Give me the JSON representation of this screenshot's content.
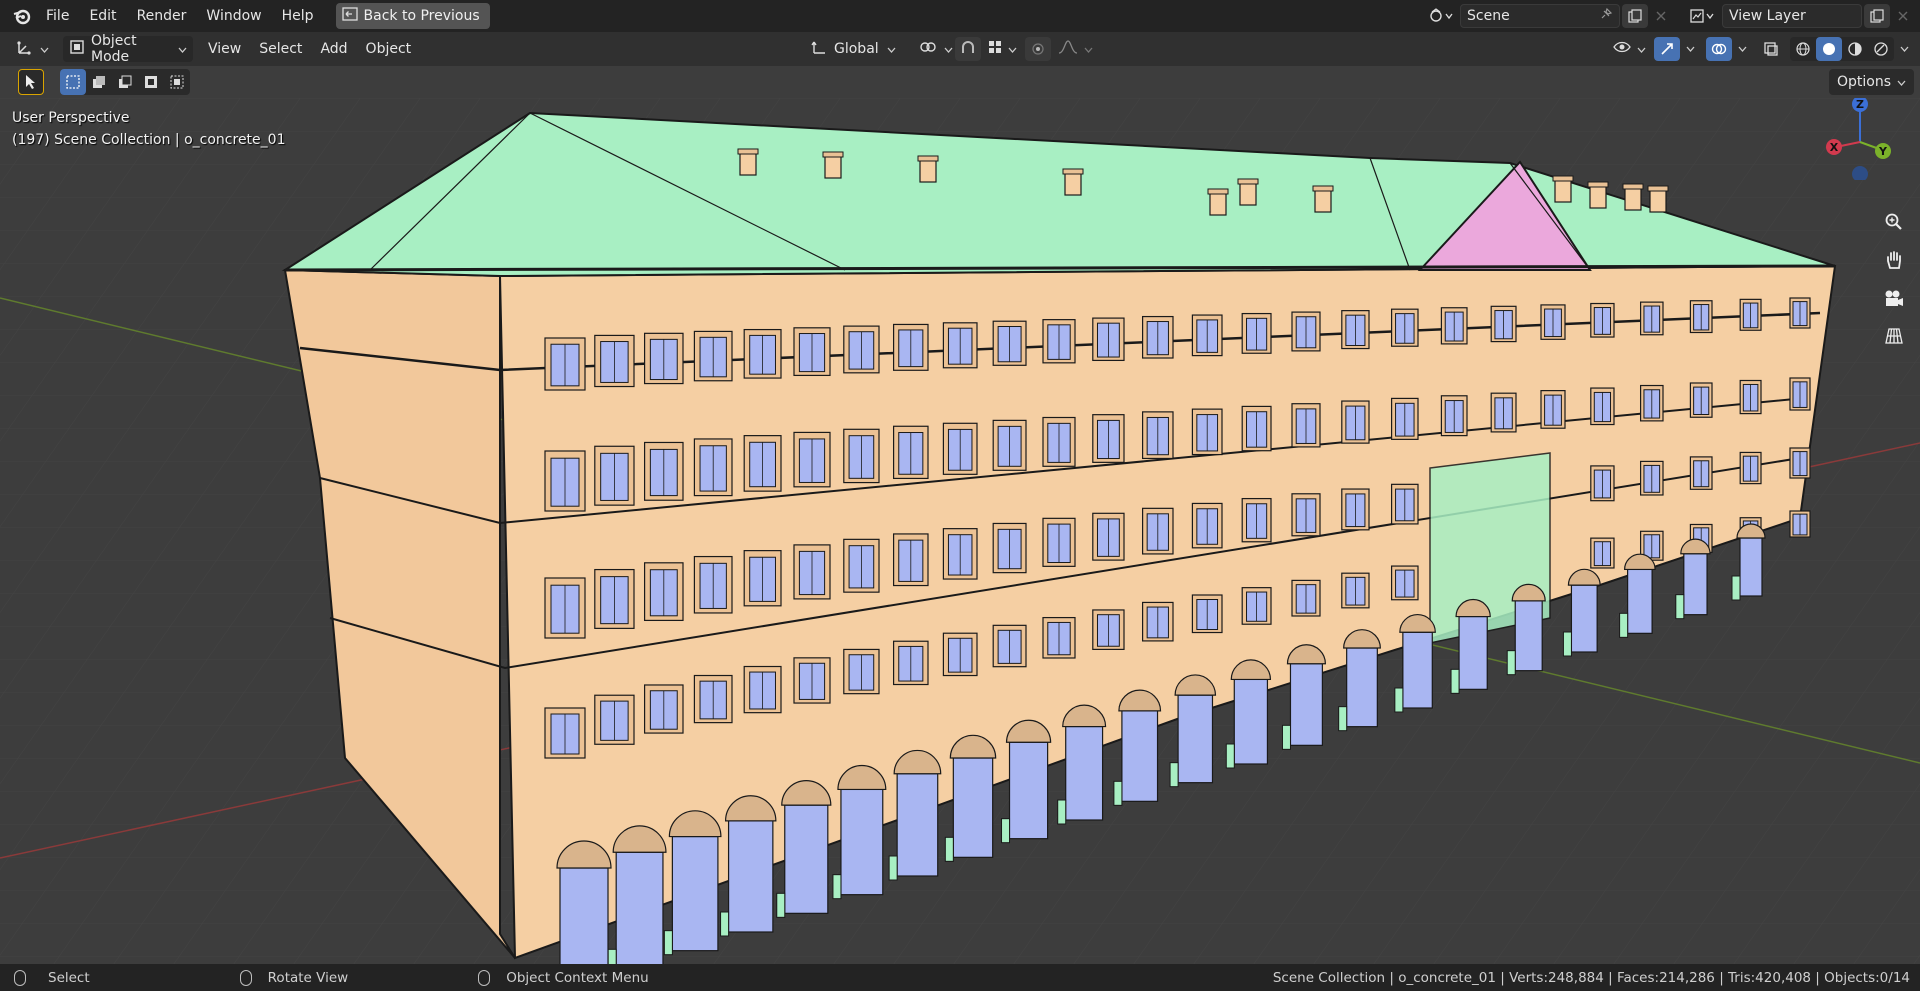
{
  "menu": {
    "file": "File",
    "edit": "Edit",
    "render": "Render",
    "window": "Window",
    "help": "Help",
    "back_to_previous": "Back to Previous"
  },
  "top_right": {
    "scene_name": "Scene",
    "view_layer_name": "View Layer"
  },
  "header": {
    "mode": "Object Mode",
    "view": "View",
    "select": "Select",
    "add": "Add",
    "object": "Object",
    "orientation": "Global"
  },
  "tool_row": {
    "options": "Options"
  },
  "viewport": {
    "perspective": "User Perspective",
    "collection_info": "(197) Scene Collection | o_concrete_01",
    "gizmo": {
      "z": "Z",
      "x": "X",
      "y": "Y"
    },
    "colors": {
      "facade": "#f5cfa3",
      "roof": "#a8efc3",
      "window": "#a9b6f2",
      "pediment": "#eba8dc",
      "accent_green": "#a8efc3"
    }
  },
  "status": {
    "select": "Select",
    "rotate_view": "Rotate View",
    "context_menu": "Object Context Menu",
    "stats": "Scene Collection | o_concrete_01 | Verts:248,884 | Faces:214,286 | Tris:420,408 | Objects:0/14"
  },
  "icons": {
    "blender": "blender-logo-icon",
    "back": "back-window-icon",
    "scene": "scene-icon",
    "view_layer": "view-layer-icon",
    "zoom": "zoom-icon",
    "hand": "hand-pan-icon",
    "camera": "camera-icon",
    "grid": "perspective-grid-icon"
  }
}
